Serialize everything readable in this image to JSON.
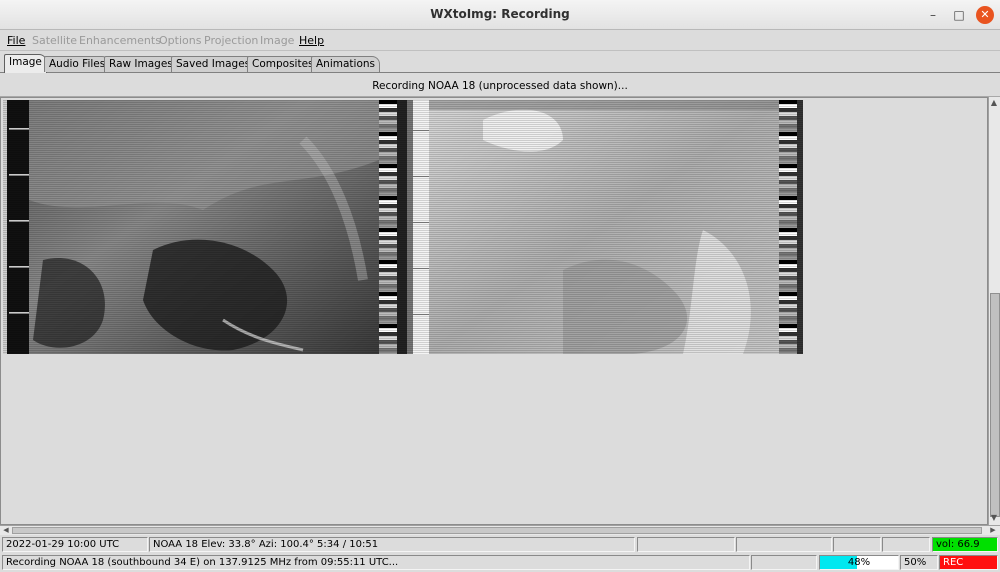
{
  "window": {
    "title": "WXtoImg: Recording"
  },
  "menu": [
    {
      "label": "File",
      "enabled": true
    },
    {
      "label": "Satellite",
      "enabled": false
    },
    {
      "label": "Enhancements",
      "enabled": false
    },
    {
      "label": "Options",
      "enabled": false
    },
    {
      "label": "Projection",
      "enabled": false
    },
    {
      "label": "Image",
      "enabled": false
    },
    {
      "label": "Help",
      "enabled": true
    }
  ],
  "tabs": [
    {
      "label": "Image",
      "active": true
    },
    {
      "label": "Audio Files",
      "active": false
    },
    {
      "label": "Raw Images",
      "active": false
    },
    {
      "label": "Saved Images",
      "active": false
    },
    {
      "label": "Composites",
      "active": false
    },
    {
      "label": "Animations",
      "active": false
    }
  ],
  "status_message": "Recording NOAA 18 (unprocessed data shown)...",
  "statusbar": {
    "datetime": "2022-01-29  10:00 UTC",
    "pass_info": "NOAA 18   Elev: 33.8°   Azi: 100.4°   5:34 / 10:51",
    "volume": "vol: 66.9",
    "recording_info": "Recording NOAA 18 (southbound 34 E) on 137.9125 MHz from 09:55:11 UTC...",
    "progress_label": "48%",
    "progress_value": 0.48,
    "percent": "50%",
    "rec_label": "REC"
  },
  "colors": {
    "volume_bg": "#00e000",
    "rec_bg": "#ff1010",
    "progress_fill": "#00e8f0",
    "close_button": "#e95420"
  },
  "icons": {
    "minimize": "minimize-icon",
    "maximize": "maximize-icon",
    "close": "close-icon"
  }
}
